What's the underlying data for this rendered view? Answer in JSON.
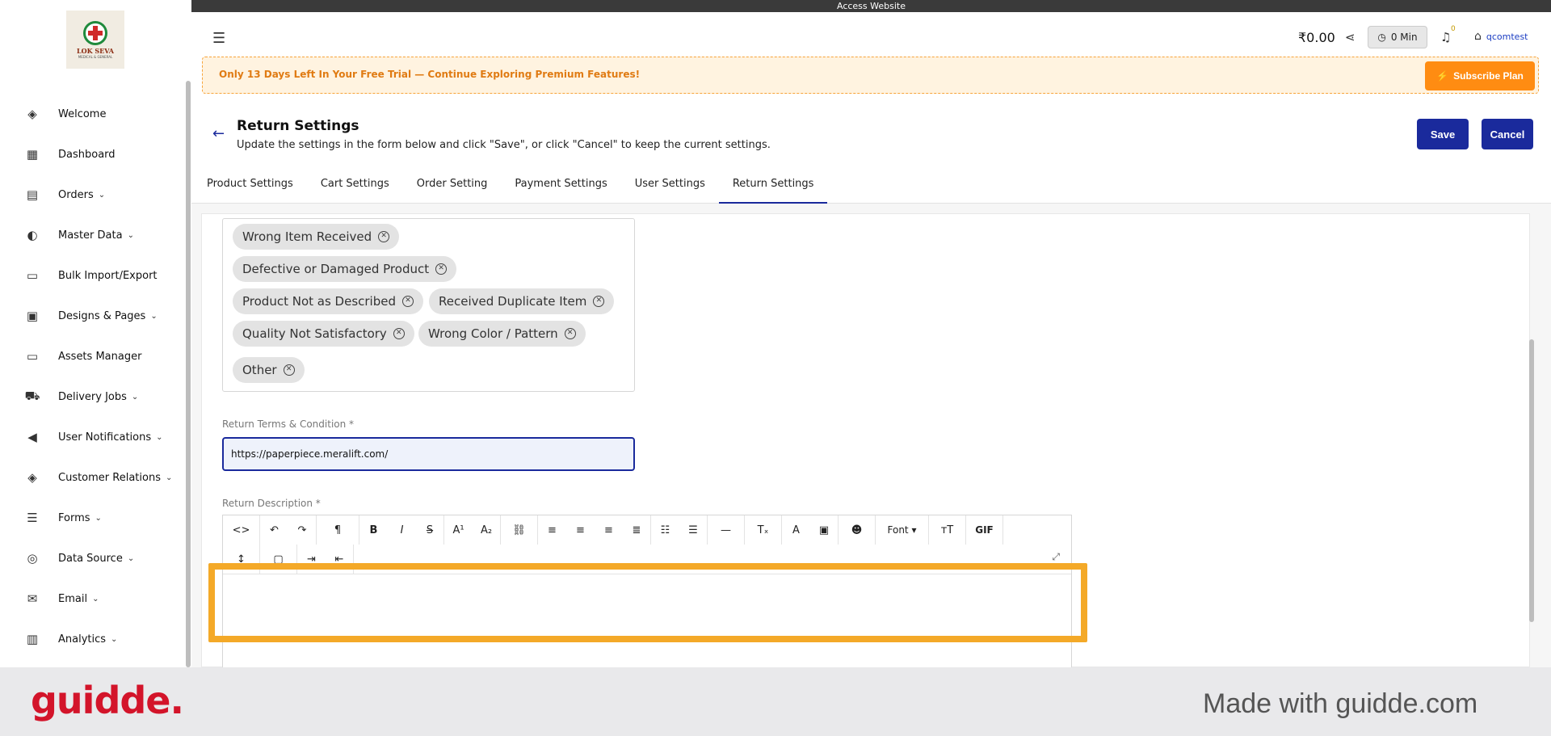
{
  "topbar": {
    "text": "Access Website"
  },
  "sidebar": {
    "logo": {
      "name": "LOK SEVA",
      "sub": "MEDICAL & GENERAL"
    },
    "items": [
      {
        "label": "Welcome",
        "icon": "welcome-icon",
        "chevron": false
      },
      {
        "label": "Dashboard",
        "icon": "dashboard-icon",
        "chevron": false
      },
      {
        "label": "Orders",
        "icon": "orders-icon",
        "chevron": true
      },
      {
        "label": "Master Data",
        "icon": "master-data-icon",
        "chevron": true
      },
      {
        "label": "Bulk Import/Export",
        "icon": "folder-icon",
        "chevron": false
      },
      {
        "label": "Designs & Pages",
        "icon": "designs-icon",
        "chevron": true
      },
      {
        "label": "Assets Manager",
        "icon": "folder-icon",
        "chevron": false
      },
      {
        "label": "Delivery Jobs",
        "icon": "delivery-icon",
        "chevron": true
      },
      {
        "label": "User Notifications",
        "icon": "megaphone-icon",
        "chevron": true
      },
      {
        "label": "Customer Relations",
        "icon": "handshake-icon",
        "chevron": true
      },
      {
        "label": "Forms",
        "icon": "forms-icon",
        "chevron": true
      },
      {
        "label": "Data Source",
        "icon": "database-icon",
        "chevron": true
      },
      {
        "label": "Email",
        "icon": "email-icon",
        "chevron": true
      },
      {
        "label": "Analytics",
        "icon": "analytics-icon",
        "chevron": true
      }
    ]
  },
  "header": {
    "balance": "₹0.00",
    "timer": "0 Min",
    "notifications_count": "0",
    "store_name": "qcomtest"
  },
  "trial": {
    "message": "Only 13 Days Left In Your Free Trial — Continue Exploring Premium Features!",
    "button": "Subscribe Plan"
  },
  "page": {
    "title": "Return Settings",
    "subtitle": "Update the settings in the form below and click \"Save\", or click \"Cancel\" to keep the current settings.",
    "save": "Save",
    "cancel": "Cancel"
  },
  "tabs": [
    {
      "label": "Product Settings",
      "active": false
    },
    {
      "label": "Cart Settings",
      "active": false
    },
    {
      "label": "Order Setting",
      "active": false
    },
    {
      "label": "Payment Settings",
      "active": false
    },
    {
      "label": "User Settings",
      "active": false
    },
    {
      "label": "Return Settings",
      "active": true
    }
  ],
  "return_reasons": [
    "Wrong Item Received",
    "Defective or Damaged Product",
    "Product Not as Described",
    "Received Duplicate Item",
    "Quality Not Satisfactory",
    "Wrong Color / Pattern",
    "Other"
  ],
  "terms": {
    "label": "Return Terms & Condition *",
    "value": "https://paperpiece.meralift.com/"
  },
  "description": {
    "label": "Return Description *",
    "font_label": "Font",
    "gif_label": "GIF"
  },
  "footer": {
    "brand": "guidde.",
    "made_with": "Made with guidde.com"
  },
  "colors": {
    "primary": "#1a2a9c",
    "accent_orange": "#ff8c12",
    "highlight": "#f4a928",
    "brand_red": "#d3142a"
  }
}
